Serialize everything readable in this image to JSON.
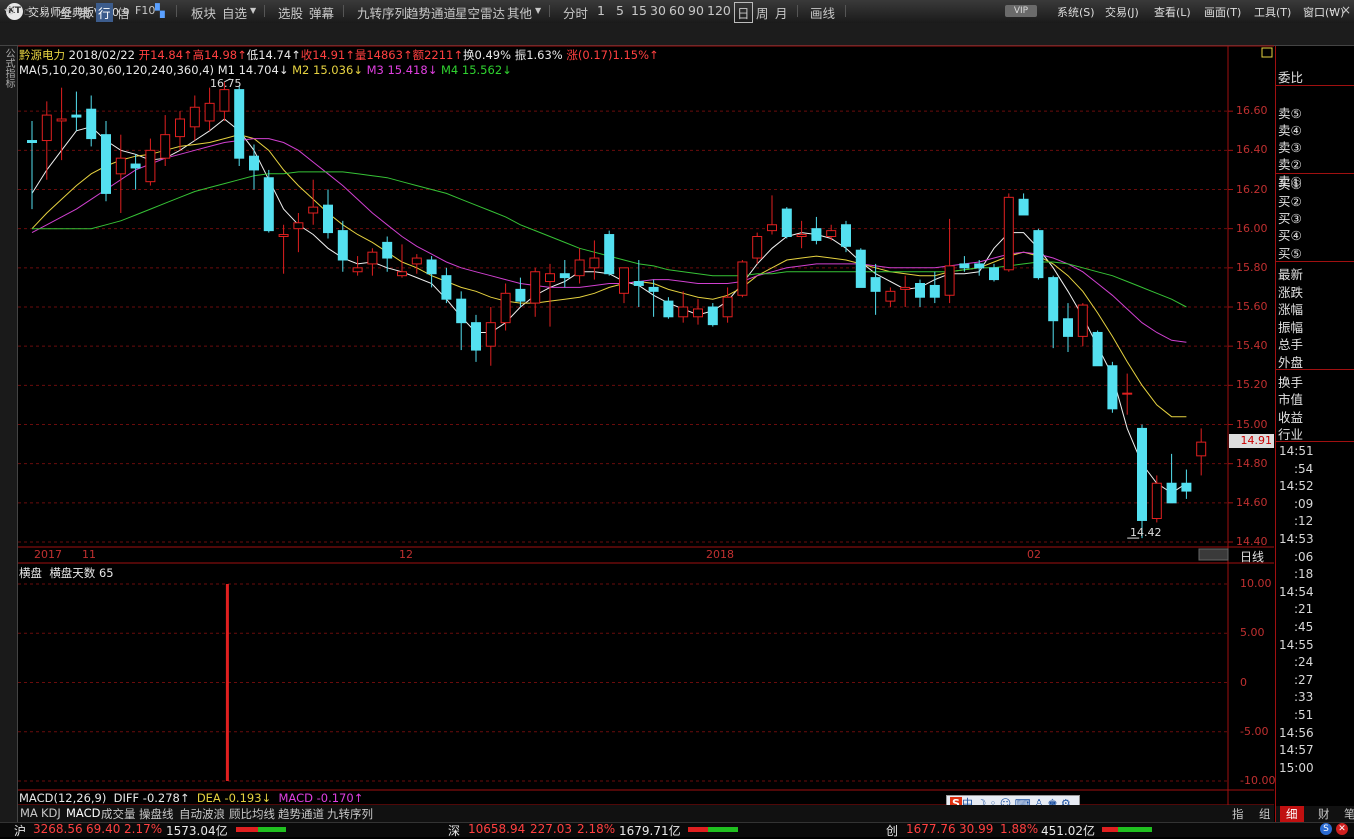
{
  "app": {
    "title": "交易师经典版V2.0.9",
    "vip": "VIP",
    "logo": "KT"
  },
  "menus": [
    "系统(S)",
    "交易(J)",
    "查看(L)",
    "画面(T)",
    "工具(T)",
    "窗口(W)"
  ],
  "toolbar": {
    "items": [
      "全",
      "策",
      "行",
      "信",
      "F10",
      "板块",
      "自选",
      "选股",
      "弹幕",
      "九转序列",
      "趋势通道",
      "星空雷达",
      "其他",
      "分时",
      "1",
      "5",
      "15",
      "30",
      "60",
      "90",
      "120",
      "日",
      "周",
      "月",
      "画线"
    ],
    "selected": "行",
    "period_selected": "日"
  },
  "left_tab": "公式指标",
  "stock": {
    "name": "黔源电力",
    "date": "2018/02/22",
    "open": "开14.84↑",
    "high": "高14.98↑",
    "low": "低14.74↑",
    "close": "收14.91↑",
    "volume": "量14863↑",
    "amount": "额2211↑",
    "turnover": "换0.49%",
    "amplitude": "振1.63%",
    "change": "涨(0.17)1.15%↑"
  },
  "ma": {
    "label": "MA(5,10,20,30,60,120,240,360,4)",
    "m1": "M1 14.704↓",
    "m2": "M2 15.036↓",
    "m3": "M3 15.418↓",
    "m4": "M4 15.562↓"
  },
  "price_axis": [
    "16.60",
    "16.40",
    "16.20",
    "16.00",
    "15.80",
    "15.60",
    "15.40",
    "15.20",
    "15.00",
    "14.80",
    "14.60",
    "14.40"
  ],
  "price_tag": "14.91",
  "high_label": "16.75",
  "low_label": "14.42",
  "date_axis": {
    "labels": [
      "2017",
      "11",
      "12",
      "2018",
      "02"
    ],
    "daily_line": "日线"
  },
  "indicator": {
    "name": "横盘",
    "days_label": "横盘天数 65",
    "axis": [
      "10.00",
      "5.00",
      "0",
      "-5.00",
      "-10.00"
    ]
  },
  "macd": {
    "label": "MACD(12,26,9)",
    "diff": "DIFF -0.278↑",
    "dea": "DEA -0.193↓",
    "macd": "MACD -0.170↑"
  },
  "bottom_tabs": [
    "MA",
    "KDJ",
    "MACD",
    "成交量",
    "操盘线",
    "自动波浪",
    "顾比均线",
    "趋势通道",
    "九转序列"
  ],
  "right_panel": {
    "header": "委比",
    "sell": [
      "卖⑤",
      "卖④",
      "卖③",
      "卖②",
      "卖①"
    ],
    "buy": [
      "买①",
      "买②",
      "买③",
      "买④",
      "买⑤"
    ],
    "stats": [
      "最新",
      "涨跌",
      "涨幅",
      "振幅",
      "总手",
      "外盘"
    ],
    "stats2": [
      "换手",
      "市值",
      "收益",
      "行业"
    ],
    "times": [
      "14:51",
      ":54",
      "14:52",
      ":09",
      ":12",
      "14:53",
      ":06",
      ":18",
      "14:54",
      ":21",
      ":45",
      "14:55",
      ":24",
      ":27",
      ":33",
      ":51",
      "14:56",
      "14:57",
      "15:00"
    ],
    "bottom_tabs": [
      "指",
      "组",
      "细",
      "财",
      "笔"
    ]
  },
  "status_bar": {
    "sh": {
      "label": "沪",
      "index": "3268.56",
      "chg": "69.40",
      "pct": "2.17%",
      "amt": "1573.04亿"
    },
    "sz": {
      "label": "深",
      "index": "10658.94",
      "chg": "227.03",
      "pct": "2.18%",
      "amt": "1679.71亿"
    },
    "cy": {
      "label": "创",
      "index": "1677.76",
      "chg": "30.99",
      "pct": "1.88%",
      "amt": "451.02亿"
    }
  },
  "ime": {
    "label": "S中"
  },
  "chart_data": {
    "type": "candlestick",
    "price_range": [
      14.4,
      16.8
    ],
    "candles": [
      {
        "o": 16.45,
        "h": 16.55,
        "l": 16.1,
        "c": 16.44
      },
      {
        "o": 16.45,
        "h": 16.65,
        "l": 16.25,
        "c": 16.58
      },
      {
        "o": 16.55,
        "h": 16.72,
        "l": 16.35,
        "c": 16.56
      },
      {
        "o": 16.58,
        "h": 16.7,
        "l": 16.5,
        "c": 16.57
      },
      {
        "o": 16.61,
        "h": 16.68,
        "l": 16.42,
        "c": 16.46
      },
      {
        "o": 16.48,
        "h": 16.55,
        "l": 16.14,
        "c": 16.18
      },
      {
        "o": 16.28,
        "h": 16.48,
        "l": 16.08,
        "c": 16.36
      },
      {
        "o": 16.33,
        "h": 16.38,
        "l": 16.2,
        "c": 16.31
      },
      {
        "o": 16.24,
        "h": 16.46,
        "l": 16.22,
        "c": 16.4
      },
      {
        "o": 16.36,
        "h": 16.58,
        "l": 16.32,
        "c": 16.48
      },
      {
        "o": 16.47,
        "h": 16.6,
        "l": 16.4,
        "c": 16.56
      },
      {
        "o": 16.52,
        "h": 16.68,
        "l": 16.45,
        "c": 16.62
      },
      {
        "o": 16.55,
        "h": 16.72,
        "l": 16.5,
        "c": 16.64
      },
      {
        "o": 16.6,
        "h": 16.75,
        "l": 16.55,
        "c": 16.71
      },
      {
        "o": 16.71,
        "h": 16.73,
        "l": 16.32,
        "c": 16.36
      },
      {
        "o": 16.37,
        "h": 16.43,
        "l": 16.2,
        "c": 16.3
      },
      {
        "o": 16.26,
        "h": 16.3,
        "l": 15.98,
        "c": 15.99
      },
      {
        "o": 15.96,
        "h": 16.02,
        "l": 15.77,
        "c": 15.97
      },
      {
        "o": 16.0,
        "h": 16.08,
        "l": 15.88,
        "c": 16.03
      },
      {
        "o": 16.08,
        "h": 16.25,
        "l": 16.02,
        "c": 16.11
      },
      {
        "o": 16.12,
        "h": 16.2,
        "l": 15.95,
        "c": 15.98
      },
      {
        "o": 15.99,
        "h": 16.04,
        "l": 15.78,
        "c": 15.84
      },
      {
        "o": 15.78,
        "h": 15.86,
        "l": 15.76,
        "c": 15.8
      },
      {
        "o": 15.82,
        "h": 15.9,
        "l": 15.76,
        "c": 15.88
      },
      {
        "o": 15.93,
        "h": 15.96,
        "l": 15.78,
        "c": 15.85
      },
      {
        "o": 15.76,
        "h": 15.92,
        "l": 15.75,
        "c": 15.78
      },
      {
        "o": 15.82,
        "h": 15.87,
        "l": 15.77,
        "c": 15.85
      },
      {
        "o": 15.84,
        "h": 15.86,
        "l": 15.7,
        "c": 15.77
      },
      {
        "o": 15.76,
        "h": 15.8,
        "l": 15.62,
        "c": 15.64
      },
      {
        "o": 15.64,
        "h": 15.68,
        "l": 15.38,
        "c": 15.52
      },
      {
        "o": 15.52,
        "h": 15.56,
        "l": 15.32,
        "c": 15.38
      },
      {
        "o": 15.4,
        "h": 15.6,
        "l": 15.3,
        "c": 15.52
      },
      {
        "o": 15.52,
        "h": 15.72,
        "l": 15.48,
        "c": 15.67
      },
      {
        "o": 15.69,
        "h": 15.75,
        "l": 15.6,
        "c": 15.63
      },
      {
        "o": 15.62,
        "h": 15.8,
        "l": 15.55,
        "c": 15.78
      },
      {
        "o": 15.73,
        "h": 15.82,
        "l": 15.5,
        "c": 15.77
      },
      {
        "o": 15.77,
        "h": 15.84,
        "l": 15.7,
        "c": 15.75
      },
      {
        "o": 15.76,
        "h": 15.9,
        "l": 15.72,
        "c": 15.84
      },
      {
        "o": 15.8,
        "h": 15.94,
        "l": 15.74,
        "c": 15.85
      },
      {
        "o": 15.97,
        "h": 15.99,
        "l": 15.76,
        "c": 15.77
      },
      {
        "o": 15.67,
        "h": 15.8,
        "l": 15.62,
        "c": 15.8
      },
      {
        "o": 15.73,
        "h": 15.84,
        "l": 15.6,
        "c": 15.71
      },
      {
        "o": 15.7,
        "h": 15.74,
        "l": 15.55,
        "c": 15.68
      },
      {
        "o": 15.63,
        "h": 15.65,
        "l": 15.54,
        "c": 15.55
      },
      {
        "o": 15.55,
        "h": 15.68,
        "l": 15.52,
        "c": 15.6
      },
      {
        "o": 15.55,
        "h": 15.64,
        "l": 15.51,
        "c": 15.59
      },
      {
        "o": 15.6,
        "h": 15.62,
        "l": 15.5,
        "c": 15.51
      },
      {
        "o": 15.55,
        "h": 15.7,
        "l": 15.52,
        "c": 15.65
      },
      {
        "o": 15.66,
        "h": 15.84,
        "l": 15.65,
        "c": 15.83
      },
      {
        "o": 15.85,
        "h": 15.98,
        "l": 15.82,
        "c": 15.96
      },
      {
        "o": 15.99,
        "h": 16.17,
        "l": 15.97,
        "c": 16.02
      },
      {
        "o": 16.1,
        "h": 16.11,
        "l": 15.95,
        "c": 15.96
      },
      {
        "o": 15.96,
        "h": 16.04,
        "l": 15.9,
        "c": 15.97
      },
      {
        "o": 16.0,
        "h": 16.06,
        "l": 15.92,
        "c": 15.94
      },
      {
        "o": 15.96,
        "h": 16.02,
        "l": 15.94,
        "c": 15.99
      },
      {
        "o": 16.02,
        "h": 16.04,
        "l": 15.88,
        "c": 15.91
      },
      {
        "o": 15.89,
        "h": 15.9,
        "l": 15.7,
        "c": 15.7
      },
      {
        "o": 15.75,
        "h": 15.82,
        "l": 15.56,
        "c": 15.68
      },
      {
        "o": 15.63,
        "h": 15.7,
        "l": 15.6,
        "c": 15.68
      },
      {
        "o": 15.69,
        "h": 15.76,
        "l": 15.6,
        "c": 15.7
      },
      {
        "o": 15.72,
        "h": 15.74,
        "l": 15.6,
        "c": 15.65
      },
      {
        "o": 15.71,
        "h": 15.78,
        "l": 15.62,
        "c": 15.65
      },
      {
        "o": 15.66,
        "h": 16.05,
        "l": 15.62,
        "c": 15.81
      },
      {
        "o": 15.82,
        "h": 15.86,
        "l": 15.78,
        "c": 15.8
      },
      {
        "o": 15.82,
        "h": 15.84,
        "l": 15.76,
        "c": 15.8
      },
      {
        "o": 15.8,
        "h": 15.82,
        "l": 15.73,
        "c": 15.74
      },
      {
        "o": 15.79,
        "h": 16.18,
        "l": 15.78,
        "c": 16.16
      },
      {
        "o": 16.15,
        "h": 16.18,
        "l": 16.08,
        "c": 16.07
      },
      {
        "o": 15.99,
        "h": 16.0,
        "l": 15.74,
        "c": 15.75
      },
      {
        "o": 15.75,
        "h": 15.76,
        "l": 15.39,
        "c": 15.53
      },
      {
        "o": 15.54,
        "h": 15.62,
        "l": 15.37,
        "c": 15.45
      },
      {
        "o": 15.45,
        "h": 15.62,
        "l": 15.4,
        "c": 15.61
      },
      {
        "o": 15.47,
        "h": 15.48,
        "l": 15.3,
        "c": 15.3
      },
      {
        "o": 15.3,
        "h": 15.32,
        "l": 15.06,
        "c": 15.08
      },
      {
        "o": 15.16,
        "h": 15.26,
        "l": 15.05,
        "c": 15.16
      },
      {
        "o": 14.98,
        "h": 15.0,
        "l": 14.42,
        "c": 14.51
      },
      {
        "o": 14.52,
        "h": 14.74,
        "l": 14.5,
        "c": 14.7
      },
      {
        "o": 14.7,
        "h": 14.85,
        "l": 14.6,
        "c": 14.6
      },
      {
        "o": 14.7,
        "h": 14.77,
        "l": 14.62,
        "c": 14.66
      },
      {
        "o": 14.84,
        "h": 14.98,
        "l": 14.74,
        "c": 14.91
      }
    ],
    "ma_series": [
      {
        "name": "M1",
        "color": "#f0f0f0",
        "values": [
          16.18,
          16.3,
          16.4,
          16.5,
          16.52,
          16.45,
          16.4,
          16.38,
          16.35,
          16.36,
          16.4,
          16.45,
          16.5,
          16.56,
          16.5,
          16.4,
          16.25,
          16.1,
          16.02,
          15.97,
          15.9,
          15.85,
          15.82,
          15.83,
          15.8,
          15.78,
          15.75,
          15.72,
          15.64,
          15.55,
          15.47,
          15.47,
          15.52,
          15.6,
          15.66,
          15.7,
          15.73,
          15.78,
          15.78,
          15.77,
          15.73,
          15.71,
          15.66,
          15.62,
          15.59,
          15.56,
          15.58,
          15.63,
          15.72,
          15.82,
          15.9,
          15.96,
          15.98,
          15.97,
          15.95,
          15.9,
          15.83,
          15.77,
          15.73,
          15.69,
          15.7,
          15.74,
          15.77,
          15.77,
          15.78,
          15.9,
          15.98,
          15.98,
          15.9,
          15.8,
          15.68,
          15.55,
          15.4,
          15.25,
          14.98,
          14.8,
          14.7,
          14.65,
          14.7
        ]
      },
      {
        "name": "M2",
        "color": "#e6d240",
        "values": [
          16.0,
          16.08,
          16.15,
          16.22,
          16.28,
          16.32,
          16.35,
          16.37,
          16.38,
          16.4,
          16.42,
          16.43,
          16.44,
          16.46,
          16.48,
          16.46,
          16.4,
          16.3,
          16.22,
          16.15,
          16.08,
          16.02,
          15.97,
          15.93,
          15.88,
          15.83,
          15.8,
          15.76,
          15.73,
          15.7,
          15.68,
          15.65,
          15.63,
          15.62,
          15.62,
          15.63,
          15.64,
          15.65,
          15.67,
          15.7,
          15.72,
          15.73,
          15.72,
          15.69,
          15.67,
          15.65,
          15.64,
          15.66,
          15.7,
          15.76,
          15.8,
          15.84,
          15.85,
          15.86,
          15.85,
          15.84,
          15.82,
          15.8,
          15.78,
          15.77,
          15.76,
          15.76,
          15.78,
          15.79,
          15.8,
          15.83,
          15.86,
          15.88,
          15.86,
          15.82,
          15.76,
          15.68,
          15.57,
          15.45,
          15.32,
          15.2,
          15.1,
          15.04,
          15.04
        ]
      },
      {
        "name": "M3",
        "color": "#d040d0",
        "values": [
          15.98,
          16.02,
          16.06,
          16.1,
          16.15,
          16.2,
          16.25,
          16.3,
          16.33,
          16.36,
          16.38,
          16.4,
          16.42,
          16.44,
          16.45,
          16.46,
          16.46,
          16.44,
          16.4,
          16.34,
          16.28,
          16.22,
          16.15,
          16.08,
          16.02,
          15.96,
          15.91,
          15.87,
          15.83,
          15.8,
          15.78,
          15.76,
          15.74,
          15.72,
          15.71,
          15.7,
          15.7,
          15.7,
          15.71,
          15.72,
          15.72,
          15.73,
          15.74,
          15.74,
          15.73,
          15.72,
          15.72,
          15.72,
          15.73,
          15.76,
          15.78,
          15.8,
          15.81,
          15.82,
          15.82,
          15.82,
          15.82,
          15.81,
          15.8,
          15.8,
          15.8,
          15.8,
          15.81,
          15.82,
          15.83,
          15.85,
          15.87,
          15.88,
          15.87,
          15.85,
          15.82,
          15.78,
          15.72,
          15.66,
          15.59,
          15.52,
          15.47,
          15.43,
          15.42
        ]
      },
      {
        "name": "M4",
        "color": "#36c236",
        "values": [
          16.0,
          16.0,
          16.0,
          16.0,
          16.0,
          16.02,
          16.04,
          16.07,
          16.1,
          16.13,
          16.16,
          16.19,
          16.21,
          16.23,
          16.25,
          16.27,
          16.28,
          16.28,
          16.29,
          16.29,
          16.29,
          16.29,
          16.28,
          16.27,
          16.26,
          16.24,
          16.22,
          16.2,
          16.18,
          16.15,
          16.12,
          16.09,
          16.06,
          16.02,
          15.99,
          15.96,
          15.93,
          15.9,
          15.88,
          15.86,
          15.84,
          15.82,
          15.81,
          15.79,
          15.78,
          15.77,
          15.76,
          15.76,
          15.76,
          15.77,
          15.77,
          15.78,
          15.78,
          15.78,
          15.78,
          15.78,
          15.78,
          15.78,
          15.78,
          15.78,
          15.78,
          15.78,
          15.78,
          15.79,
          15.8,
          15.8,
          15.81,
          15.82,
          15.83,
          15.83,
          15.82,
          15.8,
          15.78,
          15.76,
          15.73,
          15.7,
          15.67,
          15.64,
          15.6
        ]
      }
    ],
    "indicator_bars": [
      {
        "index": 13,
        "value": 10
      }
    ]
  }
}
